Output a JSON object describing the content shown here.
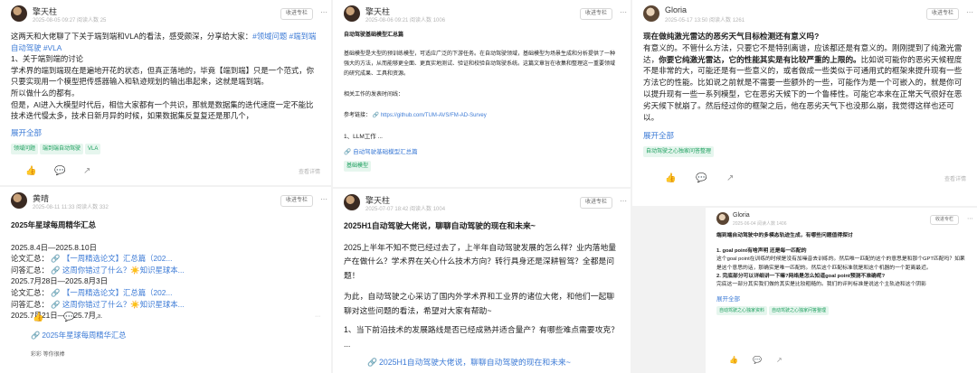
{
  "common": {
    "collect_label": "收进专栏",
    "expand_label": "展开全部",
    "detail_label": "查看详情",
    "more_icon": "⋯",
    "like_icon": "thumb-up",
    "comment_icon": "comment",
    "share_icon": "share",
    "link_icon": "link"
  },
  "colors": {
    "link": "#3d7bd6",
    "tag_text": "#1a9e5c",
    "tag_bg": "#e6f6ee"
  },
  "post1": {
    "author": "擎天柱",
    "meta": "2025-08-05 09:27  阅读人数 25",
    "line1": "这两天和大佬聊了下关于端到端和VLA的看法，感受颇深，分享给大家：",
    "hashtags1": "#领域问题 #端到端自动驾驶 #VLA",
    "body": [
      "1、关于端到端的讨论",
      "学术界的端到端现在是遍地开花的状态，但真正落地的，毕竟【端到端】只是一个范式，你只要实现用一个模型把传感器输入和轨迹规划的输出串起来，这就是端到端。",
      "所以做什么的都有。",
      "但是，AI进入大模型时代后，相信大家都有一个共识，那就是数据集的迭代速度一定不能比技术迭代慢太多，技术日新月异的时候，如果数据集反复复还是那几个，"
    ],
    "tags": [
      "领域问题",
      "端到端自动驾驶",
      "VLA"
    ]
  },
  "post2": {
    "author": "擎天柱",
    "meta": "2025-08-06 09:21  阅读人数 1006",
    "title": "自动驾驶基础模型汇总篇",
    "body": "基础模型是大型的预训练模型，可适应广泛的下游任务。在自动驾驶领域，基础模型为场景生成和分析提供了一种强大的方法，从而能够更全面、更真实地测试、验证和校验自动驾驶系统。这篇文章旨在收集和整理这一重要领域的研究成果、工具和资源。",
    "related": "相关工作的发表时间线：",
    "ref_label": "参考链接：",
    "ref_link": "https://github.com/TUM-AVS/FM-AD-Survey",
    "toc": "1、LLM工作 ...",
    "bottom_link": "自动驾驶基础模型汇总篇",
    "tags": [
      "基础模型"
    ]
  },
  "post3": {
    "author": "Gloria",
    "meta": "2025-05-17 13:50  阅读人数 1261",
    "question": "现在做纯激光雷达的恶劣天气目标检测还有意义吗?",
    "body_pre": "有意义的。不管什么方法，只要它不是特别离谱，应该都还是有意义的。刚刚提到了纯激光雷达，",
    "body_bold": "你要它纯激光雷达，它的性能其实是有比较严重的上限的。",
    "body_post": "比如说可能你的恶劣天候程度不是非常的大，可能还是有一些意义的，或者做成一些类似于可通用式的框架来提升现有一些方法它的性能。比如说之前就是不需要一些额外的一些，可能作为是一个可嵌入的，就是你可以提升现有一些一系列模型，它在恶劣天候下的一个鲁棒性。可能它本来在正常天气很好在恶劣天候下就崩了。然后经过你的框架之后，他在恶劣天气下也没那么崩，我觉得这样也还可以。",
    "tags": [
      "自动驾驶之心独家问答整理"
    ]
  },
  "post4": {
    "author": "黄晴",
    "meta": "2025-08-11 11:33  阅读人数 332",
    "title": "2025年星球每周精华汇总",
    "weeks": [
      {
        "range": "2025.8.4日—2025.8.10日",
        "paper_label": "论文汇总：",
        "paper_link": "【一周精选论文】汇总篇（202...",
        "qa_label": "问答汇总：",
        "qa_link": "这周你错过了什么？☀️知识星球本..."
      },
      {
        "range": "2025.7月28日—2025.8月3日",
        "paper_label": "论文汇总：",
        "paper_link": "【一周精选论文】汇总篇（202...",
        "qa_label": "问答汇总：",
        "qa_link": "这周你错过了什么？☀️知识星球本..."
      },
      {
        "range": "2025.7月21日—2025.7月..."
      }
    ],
    "bottom_link": "2025年星球每周精华汇总",
    "likes": "彩彩 等你很棒"
  },
  "post5": {
    "author": "擎天柱",
    "meta": "2025-07-07 18:42  阅读人数 1004",
    "title": "2025H1自动驾驶大佬说，聊聊自动驾驶的现在和未来~",
    "para1": "2025上半年不知不觉已经过去了，上半年自动驾驶发展的怎么样？业内落地量产在做什么？学术界在关心什么技术方向？转行具身还是深耕智驾？全都是问题！",
    "para2": "为此，自动驾驶之心采访了国内外学术界和工业界的诸位大佬，和他们一起聊聊对这些问题的看法，希望对大家有帮助~",
    "item1": "1、当下前沿技术的发展路线是否已经成熟并适合量产？有哪些难点需要攻克？ ...",
    "bottom_link": "2025H1自动驾驶大佬说，聊聊自动驾驶的现在和未来~"
  },
  "post6": {
    "author": "Gloria",
    "meta": "2025-06-04  阅读人数 1406",
    "title": "端到端自动驾驶中的多模态轨迹生成，有哪些问题值得探讨",
    "q1": "1. goal point有啥声明 还是每一匹配的",
    "a1": "这个goal point在训练的时候是没有加噪音去训练的。然后唯一匹配的这个的意思是和那个GPT匹配吗？如果是这个意思的话，那确实是唯一匹配的。然后这个匹配标准就是和这个机器的一个距离最近。",
    "q2": "2. 完底部分可以详细讲一下嘛?网络是怎么知道goal point预测不准确呢?",
    "a2": "完底这一部分其实我们做的其实是比较粗糙的。我们的评判标准是说这个主轨迹和这个阴影",
    "tags": [
      "自动驾驶之心独家资料",
      "自动驾驶之心独家问答整理"
    ]
  }
}
